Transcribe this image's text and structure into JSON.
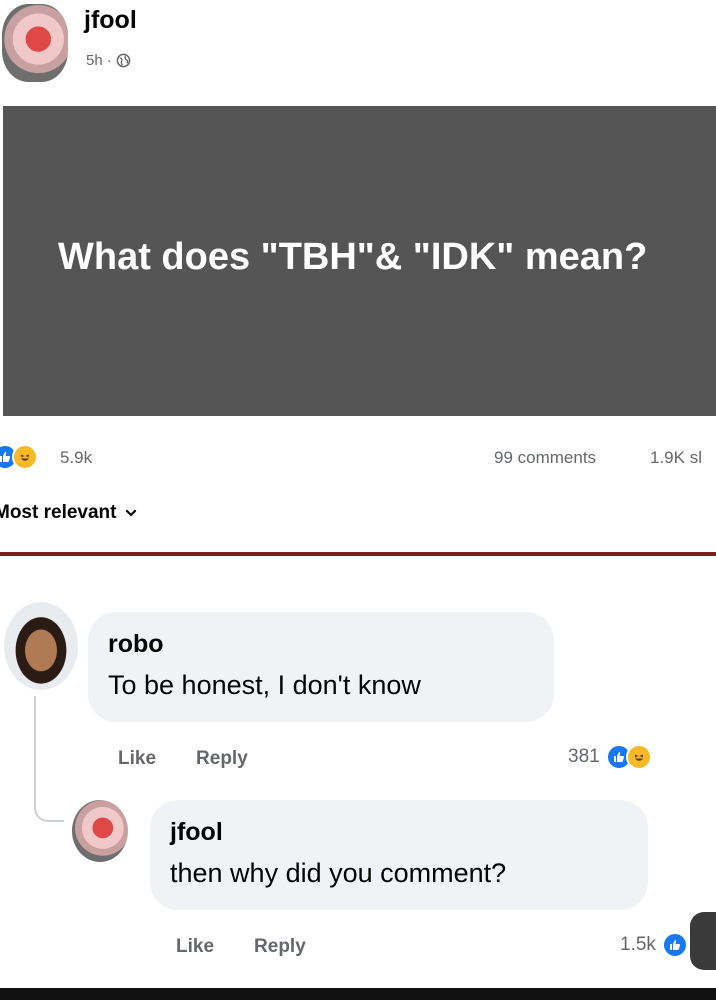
{
  "post": {
    "author": "jfool",
    "time": "5h",
    "separator": "·",
    "question": "What does \"TBH\"& \"IDK\" mean?"
  },
  "reactions": {
    "count": "5.9k",
    "comments": "99 comments",
    "shares": "1.9K sl"
  },
  "sort": {
    "label": "Most relevant"
  },
  "comments": [
    {
      "author": "robo",
      "text": "To be honest, I don't know",
      "like_label": "Like",
      "reply_label": "Reply",
      "reaction_count": "381"
    },
    {
      "author": "jfool",
      "text": "then why did you comment?",
      "like_label": "Like",
      "reply_label": "Reply",
      "reaction_count": "1.5k"
    }
  ],
  "colors": {
    "like": "#1877f2",
    "haha": "#f7b928",
    "image_bg": "#555555",
    "bubble": "#f0f2f5",
    "divider": "#7a1f1f"
  },
  "icons": [
    "globe-icon",
    "like-icon",
    "haha-icon",
    "chevron-down-icon"
  ]
}
